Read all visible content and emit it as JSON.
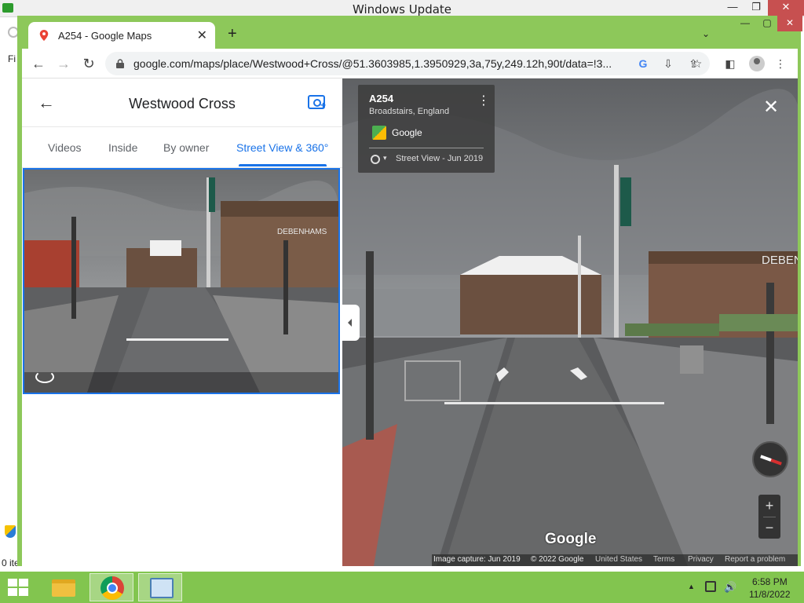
{
  "background_window": {
    "title": "Windows Update",
    "side_text": "Fi",
    "bottom_text": "0 ite",
    "controls": {
      "minimize": "—",
      "restore": "❐",
      "close": "✕"
    }
  },
  "browser": {
    "tab": {
      "title": "A254 - Google Maps",
      "close": "✕"
    },
    "new_tab": "+",
    "tab_search": "⌄",
    "window_controls": {
      "minimize": "—",
      "maximize": "▢",
      "close": "✕"
    },
    "nav": {
      "back": "←",
      "forward": "→",
      "reload": "↻"
    },
    "url": "google.com/maps/place/Westwood+Cross/@51.3603985,1.3950929,3a,75y,249.12h,90t/data=!3...",
    "icons": {
      "google": "G",
      "install": "⇩",
      "share": "⇪",
      "bookmark": "☆",
      "sidepanel": "◧",
      "menu": "⋮"
    }
  },
  "left_panel": {
    "back": "←",
    "title": "Westwood Cross",
    "tabs": [
      {
        "label": "Videos"
      },
      {
        "label": "Inside"
      },
      {
        "label": "By owner"
      },
      {
        "label": "Street View & 360°",
        "active": true
      }
    ],
    "photo_sign": "DEBENHAMS"
  },
  "street_view": {
    "info": {
      "title": "A254",
      "subtitle": "Broadstairs, England",
      "source": "Google",
      "date_label": "Street View - Jun 2019",
      "more": "⋮",
      "caret": "▾"
    },
    "close": "✕",
    "sign": "DEBEN",
    "zoom_in": "+",
    "zoom_out": "−",
    "watermark": "Google",
    "footer": {
      "capture": "Image capture: Jun 2019",
      "copyright": "© 2022 Google",
      "country": "United States",
      "terms": "Terms",
      "privacy": "Privacy",
      "report": "Report a problem"
    }
  },
  "taskbar": {
    "tray_caret": "▲",
    "volume": "🔊",
    "time": "6:58 PM",
    "date": "11/8/2022"
  }
}
